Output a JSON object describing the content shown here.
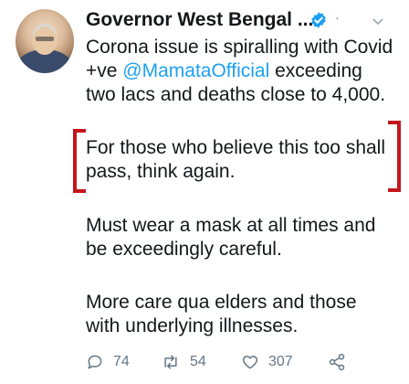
{
  "tweet": {
    "author_name": "Governor West Bengal ...",
    "dot": "·",
    "paragraphs": [
      {
        "lines": [
          "Corona issue is spiralling with Covid",
          "+ve ",
          "two lacs and deaths close to 4,000."
        ]
      },
      {
        "lines": [
          "For those who believe this too shall",
          "pass, think again."
        ]
      },
      {
        "lines": [
          "Must wear a mask at all times and",
          "be exceedingly careful."
        ]
      },
      {
        "lines": [
          "More care qua elders and those",
          "with underlying illnesses."
        ]
      }
    ],
    "mention": "@MamataOfficial",
    "mention_suffix": " exceeding"
  },
  "actions": {
    "replies": "74",
    "retweets": "54",
    "likes": "307"
  },
  "colors": {
    "mention": "#1da1f2",
    "verified": "#1da1f2",
    "bracket": "#c4161c",
    "muted": "#657786"
  }
}
